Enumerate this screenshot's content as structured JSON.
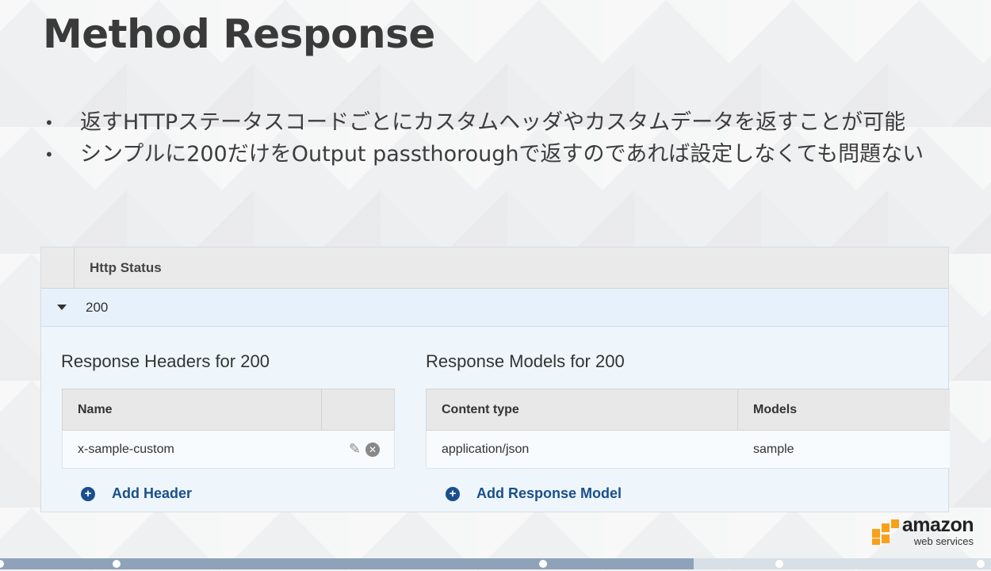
{
  "slide": {
    "title": "Method Response",
    "bullets": [
      "返すHTTPステータスコードごとにカスタムヘッダやカスタムデータを返すことが可能",
      "シンプルに200だけをOutput passthoroughで返すのであれば設定しなくても問題ない"
    ],
    "bullet_glyph": "•"
  },
  "method_response": {
    "status_header": "Http Status",
    "status_code": "200",
    "headers_section": {
      "title": "Response Headers for 200",
      "columns": [
        "Name",
        ""
      ],
      "rows": [
        {
          "name": "x-sample-custom"
        }
      ],
      "add_label": "Add Header"
    },
    "models_section": {
      "title": "Response Models for 200",
      "columns": [
        "Content type",
        "Models"
      ],
      "rows": [
        {
          "content_type": "application/json",
          "model": "sample"
        }
      ],
      "add_label": "Add Response Model"
    }
  },
  "logo": {
    "brand": "amazon",
    "sub": "web services"
  },
  "progress": {
    "fraction": 0.7
  }
}
